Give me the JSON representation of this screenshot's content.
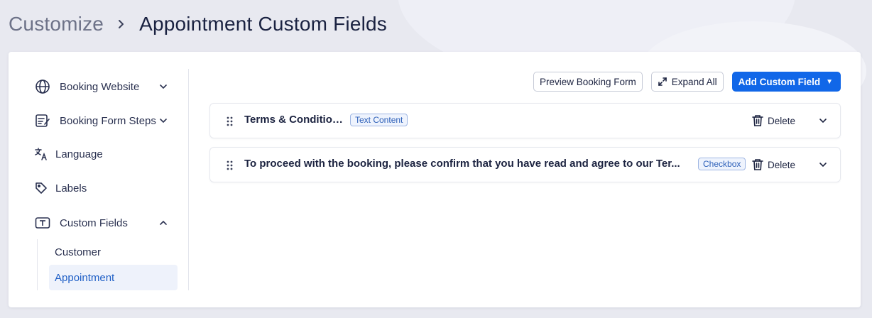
{
  "breadcrumb": {
    "parent": "Customize",
    "current": "Appointment Custom Fields"
  },
  "sidebar": {
    "items": [
      {
        "label": "Booking Website",
        "icon": "globe-icon",
        "expanded": false
      },
      {
        "label": "Booking Form Steps",
        "icon": "form-edit-icon",
        "expanded": false
      },
      {
        "label": "Language",
        "icon": "translate-icon"
      },
      {
        "label": "Labels",
        "icon": "tag-icon"
      },
      {
        "label": "Custom Fields",
        "icon": "text-field-icon",
        "expanded": true
      }
    ],
    "sub_items": [
      {
        "label": "Customer",
        "active": false
      },
      {
        "label": "Appointment",
        "active": true
      }
    ]
  },
  "toolbar": {
    "preview_label": "Preview Booking Form",
    "expand_label": "Expand All",
    "add_label": "Add Custom Field"
  },
  "fields": [
    {
      "title": "Terms & Conditions",
      "type": "Text Content",
      "delete_label": "Delete"
    },
    {
      "title": "To proceed with the booking, please confirm that you have read and agree to our Ter...",
      "type": "Checkbox",
      "delete_label": "Delete"
    }
  ],
  "colors": {
    "accent": "#1167e8",
    "active_bg": "#eef2fb",
    "active_text": "#1f5fc6"
  }
}
